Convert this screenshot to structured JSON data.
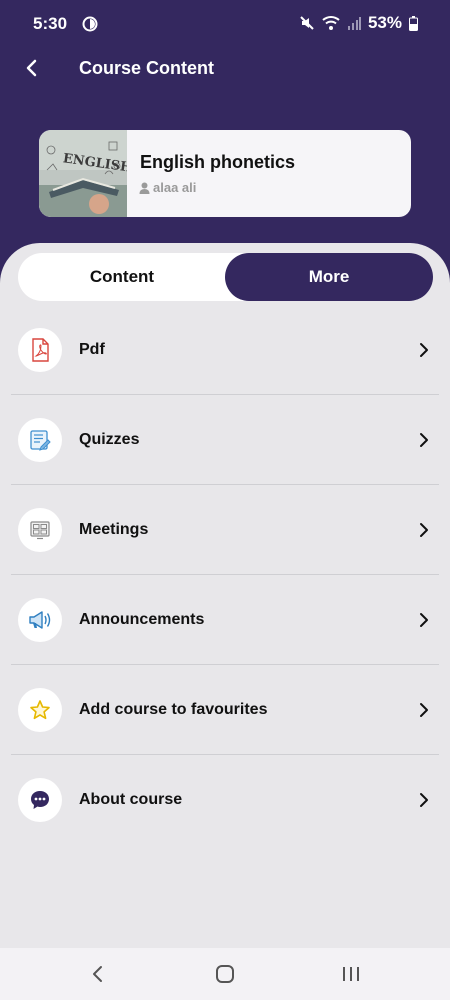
{
  "status_bar": {
    "time": "5:30",
    "battery": "53%"
  },
  "header": {
    "title": "Course Content"
  },
  "course": {
    "name": "English phonetics",
    "author": "alaa ali"
  },
  "tabs": [
    {
      "label": "Content",
      "selected": false
    },
    {
      "label": "More",
      "selected": true
    }
  ],
  "menu": [
    {
      "label": "Pdf",
      "icon": "pdf-icon"
    },
    {
      "label": "Quizzes",
      "icon": "quiz-icon"
    },
    {
      "label": "Meetings",
      "icon": "meetings-icon"
    },
    {
      "label": "Announcements",
      "icon": "megaphone-icon"
    },
    {
      "label": "Add course to favourites",
      "icon": "star-icon"
    },
    {
      "label": "About course",
      "icon": "chat-bubble-icon"
    }
  ],
  "colors": {
    "primary": "#34285f",
    "background": "#e8e7ea",
    "pdf_red": "#d9473f",
    "quiz_blue": "#3f8fcf",
    "star_yellow": "#f0c419"
  }
}
